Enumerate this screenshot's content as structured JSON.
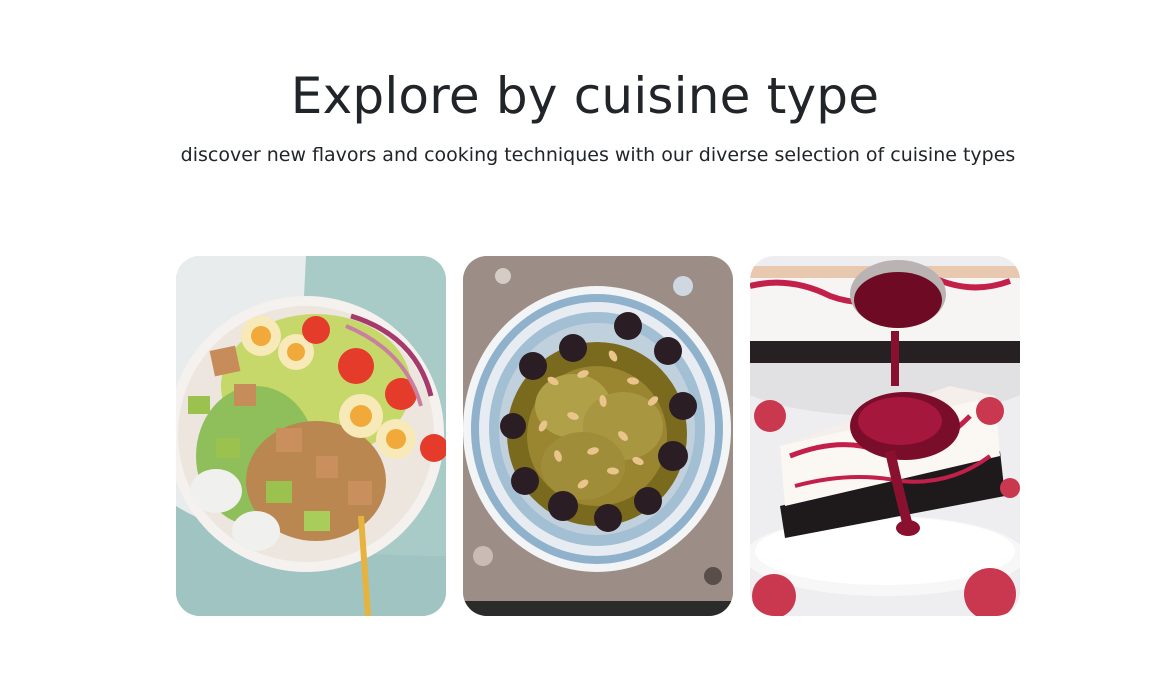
{
  "section": {
    "title": "Explore by cuisine type",
    "subtitle": "discover new flavors and cooking techniques with our diverse selection of cuisine types"
  },
  "cards": [
    {
      "image": "cobb-salad-photo"
    },
    {
      "image": "tagine-prunes-almonds-photo"
    },
    {
      "image": "raspberry-cheesecake-photo"
    }
  ]
}
